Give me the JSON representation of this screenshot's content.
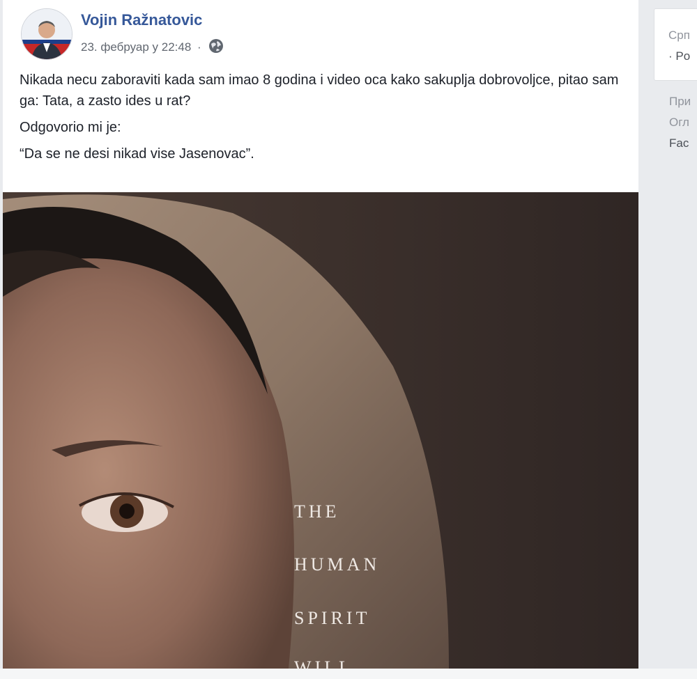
{
  "post": {
    "author": "Vojin Ražnatovic",
    "timestamp": "23. фебруар у 22:48",
    "separator": "·",
    "privacy_icon": "globe-icon",
    "paragraphs": [
      "Nikada necu zaboraviti kada sam imao 8 godina i video oca kako sakuplja dobrovoljce, pitao sam ga: Tata, a zasto ides u rat?",
      "Odgovorio mi je:",
      "“Da se ne desi nikad vise Jasenovac”."
    ],
    "image_text": [
      "THE",
      "HUMAN",
      "SPIRIT",
      "WILL"
    ]
  },
  "sidebar": {
    "language": "Срп",
    "language_sub": "· Po",
    "links": [
      "При",
      "Огл",
      "Fac"
    ]
  },
  "colors": {
    "author_link": "#365899",
    "page_background": "#e9ebee",
    "text": "#1d2129",
    "meta": "#616770"
  }
}
